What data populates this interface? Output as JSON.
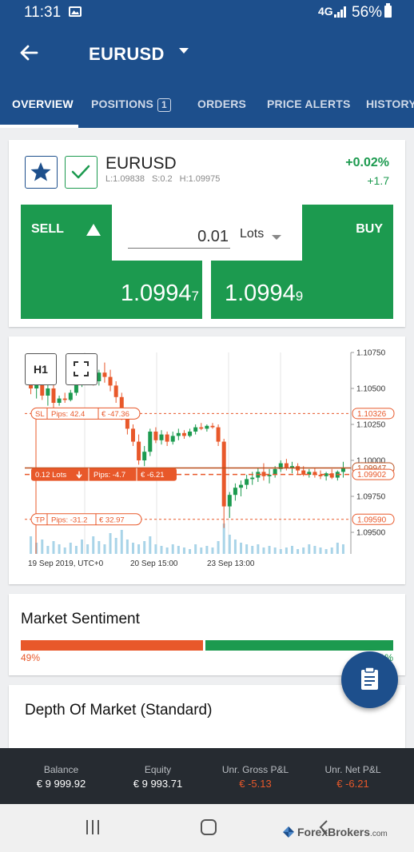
{
  "status_bar": {
    "time": "11:31",
    "battery": "56%",
    "network": "4G"
  },
  "header": {
    "symbol": "EURUSD",
    "tabs": [
      {
        "label": "OVERVIEW",
        "active": true
      },
      {
        "label": "POSITIONS",
        "badge": "1"
      },
      {
        "label": "ORDERS"
      },
      {
        "label": "PRICE ALERTS"
      },
      {
        "label": "HISTORY"
      }
    ]
  },
  "instrument": {
    "name": "EURUSD",
    "low": "L:1.09838",
    "spread": "S:0.2",
    "high": "H:1.09975",
    "change_pct": "+0.02%",
    "change_abs": "+1.7",
    "icons": {
      "favorite": "star-icon",
      "enabled": "checkmark-icon"
    }
  },
  "trade": {
    "sell_label": "SELL",
    "buy_label": "BUY",
    "sell_price_main": "1.0994",
    "sell_price_pip": "7",
    "buy_price_main": "1.0994",
    "buy_price_pip": "9",
    "lots_value": "0.01",
    "lots_label": "Lots",
    "buy_color": "#1c9a4f",
    "sell_color": "#1c9a4f"
  },
  "chart": {
    "timeframe_label": "H1",
    "y_ticks": [
      "1.10750",
      "1.10500",
      "1.10250",
      "1.10000",
      "1.09750",
      "1.09500"
    ],
    "x_ticks": [
      "19 Sep 2019, UTC+0",
      "20 Sep 15:00",
      "23 Sep 13:00"
    ],
    "sl_line": {
      "tag": "SL",
      "pips": "Pips: 42.4",
      "pnl": "€ -47.36",
      "price": "1.10326"
    },
    "tp_line": {
      "tag": "TP",
      "pips": "Pips: -31.2",
      "pnl": "€ 32.97",
      "price": "1.09590"
    },
    "position_line": {
      "lots": "0.12 Lots",
      "pips": "Pips: -4.7",
      "pnl": "€ -6.21",
      "price": "1.09902"
    },
    "current_price": "1.09947",
    "colors": {
      "up": "#1c9a4f",
      "down": "#e8582a",
      "volume": "#a9d4e8"
    }
  },
  "chart_data": {
    "type": "candlestick",
    "y_range": [
      1.0935,
      1.1075
    ],
    "candles": [
      {
        "o": 1.1062,
        "h": 1.1068,
        "l": 1.1046,
        "c": 1.105
      },
      {
        "o": 1.105,
        "h": 1.1058,
        "l": 1.1043,
        "c": 1.1054
      },
      {
        "o": 1.1054,
        "h": 1.106,
        "l": 1.1042,
        "c": 1.1045
      },
      {
        "o": 1.1045,
        "h": 1.1054,
        "l": 1.1038,
        "c": 1.105
      },
      {
        "o": 1.105,
        "h": 1.1058,
        "l": 1.1036,
        "c": 1.104
      },
      {
        "o": 1.104,
        "h": 1.1045,
        "l": 1.1038,
        "c": 1.1043
      },
      {
        "o": 1.1043,
        "h": 1.1047,
        "l": 1.104,
        "c": 1.1042
      },
      {
        "o": 1.1042,
        "h": 1.1049,
        "l": 1.1041,
        "c": 1.1047
      },
      {
        "o": 1.1047,
        "h": 1.1056,
        "l": 1.1045,
        "c": 1.1054
      },
      {
        "o": 1.1054,
        "h": 1.106,
        "l": 1.1051,
        "c": 1.1057
      },
      {
        "o": 1.1057,
        "h": 1.1062,
        "l": 1.1055,
        "c": 1.106
      },
      {
        "o": 1.106,
        "h": 1.1066,
        "l": 1.1052,
        "c": 1.1055
      },
      {
        "o": 1.1055,
        "h": 1.1063,
        "l": 1.1052,
        "c": 1.1061
      },
      {
        "o": 1.1061,
        "h": 1.1068,
        "l": 1.1054,
        "c": 1.1058
      },
      {
        "o": 1.1058,
        "h": 1.1063,
        "l": 1.1048,
        "c": 1.1052
      },
      {
        "o": 1.1052,
        "h": 1.1055,
        "l": 1.104,
        "c": 1.1044
      },
      {
        "o": 1.1044,
        "h": 1.1047,
        "l": 1.1028,
        "c": 1.1032
      },
      {
        "o": 1.1032,
        "h": 1.1035,
        "l": 1.1018,
        "c": 1.1022
      },
      {
        "o": 1.1022,
        "h": 1.1025,
        "l": 1.101,
        "c": 1.1013
      },
      {
        "o": 1.1013,
        "h": 1.1018,
        "l": 1.0997,
        "c": 1.1
      },
      {
        "o": 1.1,
        "h": 1.101,
        "l": 1.0996,
        "c": 1.1006
      },
      {
        "o": 1.1006,
        "h": 1.1022,
        "l": 1.1003,
        "c": 1.102
      },
      {
        "o": 1.102,
        "h": 1.1023,
        "l": 1.1012,
        "c": 1.1014
      },
      {
        "o": 1.1014,
        "h": 1.1021,
        "l": 1.1011,
        "c": 1.1018
      },
      {
        "o": 1.1018,
        "h": 1.102,
        "l": 1.101,
        "c": 1.1013
      },
      {
        "o": 1.1013,
        "h": 1.102,
        "l": 1.1011,
        "c": 1.1017
      },
      {
        "o": 1.1017,
        "h": 1.1022,
        "l": 1.1014,
        "c": 1.1019
      },
      {
        "o": 1.1019,
        "h": 1.1021,
        "l": 1.1015,
        "c": 1.1017
      },
      {
        "o": 1.1017,
        "h": 1.1022,
        "l": 1.1016,
        "c": 1.102
      },
      {
        "o": 1.102,
        "h": 1.1025,
        "l": 1.1018,
        "c": 1.1023
      },
      {
        "o": 1.1023,
        "h": 1.1026,
        "l": 1.1021,
        "c": 1.1022
      },
      {
        "o": 1.1022,
        "h": 1.1025,
        "l": 1.102,
        "c": 1.1024
      },
      {
        "o": 1.1024,
        "h": 1.1026,
        "l": 1.1022,
        "c": 1.1023
      },
      {
        "o": 1.1023,
        "h": 1.1025,
        "l": 1.101,
        "c": 1.1013
      },
      {
        "o": 1.1013,
        "h": 1.1015,
        "l": 1.0953,
        "c": 1.0968
      },
      {
        "o": 1.0968,
        "h": 1.0978,
        "l": 1.096,
        "c": 1.0976
      },
      {
        "o": 1.0976,
        "h": 1.0984,
        "l": 1.0972,
        "c": 1.0981
      },
      {
        "o": 1.0981,
        "h": 1.0986,
        "l": 1.0975,
        "c": 1.0983
      },
      {
        "o": 1.0983,
        "h": 1.099,
        "l": 1.098,
        "c": 1.0987
      },
      {
        "o": 1.0987,
        "h": 1.0992,
        "l": 1.0983,
        "c": 1.0988
      },
      {
        "o": 1.0988,
        "h": 1.0995,
        "l": 1.0985,
        "c": 1.0992
      },
      {
        "o": 1.0992,
        "h": 1.0998,
        "l": 1.0986,
        "c": 1.0989
      },
      {
        "o": 1.0989,
        "h": 1.0994,
        "l": 1.0984,
        "c": 1.099
      },
      {
        "o": 1.099,
        "h": 1.0996,
        "l": 1.0988,
        "c": 1.0994
      },
      {
        "o": 1.0994,
        "h": 1.1,
        "l": 1.0992,
        "c": 1.0998
      },
      {
        "o": 1.0998,
        "h": 1.1001,
        "l": 1.0993,
        "c": 1.0995
      },
      {
        "o": 1.0995,
        "h": 1.0999,
        "l": 1.0991,
        "c": 1.0996
      },
      {
        "o": 1.0996,
        "h": 1.0998,
        "l": 1.099,
        "c": 1.0993
      },
      {
        "o": 1.0993,
        "h": 1.0996,
        "l": 1.0989,
        "c": 1.099
      },
      {
        "o": 1.099,
        "h": 1.0994,
        "l": 1.0988,
        "c": 1.0992
      },
      {
        "o": 1.0992,
        "h": 1.0995,
        "l": 1.0988,
        "c": 1.099
      },
      {
        "o": 1.099,
        "h": 1.0993,
        "l": 1.0987,
        "c": 1.0989
      },
      {
        "o": 1.0989,
        "h": 1.0992,
        "l": 1.0986,
        "c": 1.0991
      },
      {
        "o": 1.0991,
        "h": 1.0994,
        "l": 1.0987,
        "c": 1.0988
      },
      {
        "o": 1.0988,
        "h": 1.0993,
        "l": 1.0986,
        "c": 1.0992
      },
      {
        "o": 1.0992,
        "h": 1.0999,
        "l": 1.0988,
        "c": 1.0995
      }
    ],
    "volumes": [
      0.55,
      0.35,
      0.45,
      0.25,
      0.4,
      0.3,
      0.2,
      0.35,
      0.25,
      0.45,
      0.3,
      0.55,
      0.4,
      0.3,
      0.65,
      0.5,
      0.75,
      0.45,
      0.35,
      0.3,
      0.4,
      0.55,
      0.3,
      0.25,
      0.2,
      0.3,
      0.25,
      0.2,
      0.15,
      0.3,
      0.2,
      0.25,
      0.2,
      0.4,
      0.95,
      0.6,
      0.45,
      0.35,
      0.3,
      0.25,
      0.3,
      0.2,
      0.25,
      0.2,
      0.15,
      0.2,
      0.25,
      0.15,
      0.2,
      0.3,
      0.25,
      0.2,
      0.15,
      0.2,
      0.35,
      0.3
    ],
    "ylabel": "",
    "xlabel": ""
  },
  "sentiment": {
    "title": "Market Sentiment",
    "sell_pct": 49,
    "buy_pct": 51,
    "sell_pct_label": "49%",
    "buy_pct_label": "51%"
  },
  "depth": {
    "title": "Depth Of Market (Standard)"
  },
  "fab": {
    "icon": "clipboard-icon"
  },
  "footer": [
    {
      "label": "Balance",
      "value": "€ 9 999.92",
      "negative": false
    },
    {
      "label": "Equity",
      "value": "€ 9 993.71",
      "negative": false
    },
    {
      "label": "Unr. Gross P&L",
      "value": "€ -5.13",
      "negative": true
    },
    {
      "label": "Unr. Net P&L",
      "value": "€ -6.21",
      "negative": true
    }
  ],
  "watermark": {
    "brand": "ForexBrokers",
    "suffix": ".com"
  }
}
